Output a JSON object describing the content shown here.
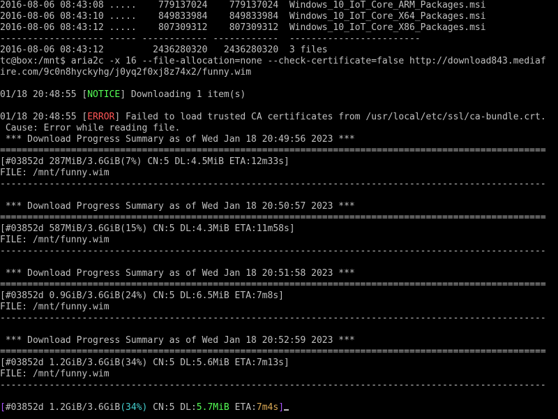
{
  "terminal": {
    "listing": [
      "2016-08-06 08:43:08 .....    779137024    779137024  Windows_10_IoT_Core_ARM_Packages.msi",
      "2016-08-06 08:43:10 .....    849833984    849833984  Windows_10_IoT_Core_X64_Packages.msi",
      "2016-08-06 08:43:12 .....    807309312    807309312  Windows_10_IoT_Core_X86_Packages.msi",
      "------------------- ----- ------------ ------------  ------------------------",
      "2016-08-06 08:43:12         2436280320   2436280320  3 files"
    ],
    "command_line_1": "tc@box:/mnt$ aria2c -x 16 --file-allocation=none --check-certificate=false http://download843.mediaf",
    "command_line_2": "ire.com/9c0n8hyckyhg/j0yq2f0xj8z74x2/funny.wim",
    "notice": {
      "time": "01/18 20:48:55 ",
      "open": "[",
      "tag": "NOTICE",
      "close": "]",
      "message": " Downloading 1 item(s)"
    },
    "error": {
      "time": "01/18 20:48:55 ",
      "open": "[",
      "tag": "ERROR",
      "close": "]",
      "message": " Failed to load trusted CA certificates from /usr/local/etc/ssl/ca-bundle.crt.",
      "cause": " Cause: Error while reading file."
    },
    "double_rule": "====================================================================================================",
    "single_rule": "----------------------------------------------------------------------------------------------------",
    "summaries": [
      {
        "header": " *** Download Progress Summary as of Wed Jan 18 20:49:56 2023 ***",
        "progress": "[#03852d 287MiB/3.6GiB(7%) CN:5 DL:4.5MiB ETA:12m33s]",
        "file": "FILE: /mnt/funny.wim"
      },
      {
        "header": " *** Download Progress Summary as of Wed Jan 18 20:50:57 2023 ***",
        "progress": "[#03852d 587MiB/3.6GiB(15%) CN:5 DL:4.3MiB ETA:11m58s]",
        "file": "FILE: /mnt/funny.wim"
      },
      {
        "header": " *** Download Progress Summary as of Wed Jan 18 20:51:58 2023 ***",
        "progress": "[#03852d 0.9GiB/3.6GiB(24%) CN:5 DL:6.5MiB ETA:7m8s]",
        "file": "FILE: /mnt/funny.wim"
      },
      {
        "header": " *** Download Progress Summary as of Wed Jan 18 20:52:59 2023 ***",
        "progress": "[#03852d 1.2GiB/3.6GiB(34%) CN:5 DL:5.6MiB ETA:7m13s]",
        "file": "FILE: /mnt/funny.wim"
      }
    ],
    "live": {
      "open": "[",
      "gid": "#03852d ",
      "size": "1.2GiB/3.6GiB",
      "pct": "(34%)",
      "cn": " CN:5 DL:",
      "dl": "5.7MiB",
      "eta_label": " ETA:",
      "eta": "7m4s",
      "close": "]"
    },
    "colors": {
      "background": "#000000",
      "foreground": "#c0c0c0",
      "notice": "#55ff55",
      "error": "#ff5555",
      "bracket": "#aa55ff",
      "percent": "#44d0d0",
      "speed": "#55ff55",
      "eta": "#ddaa55"
    }
  }
}
